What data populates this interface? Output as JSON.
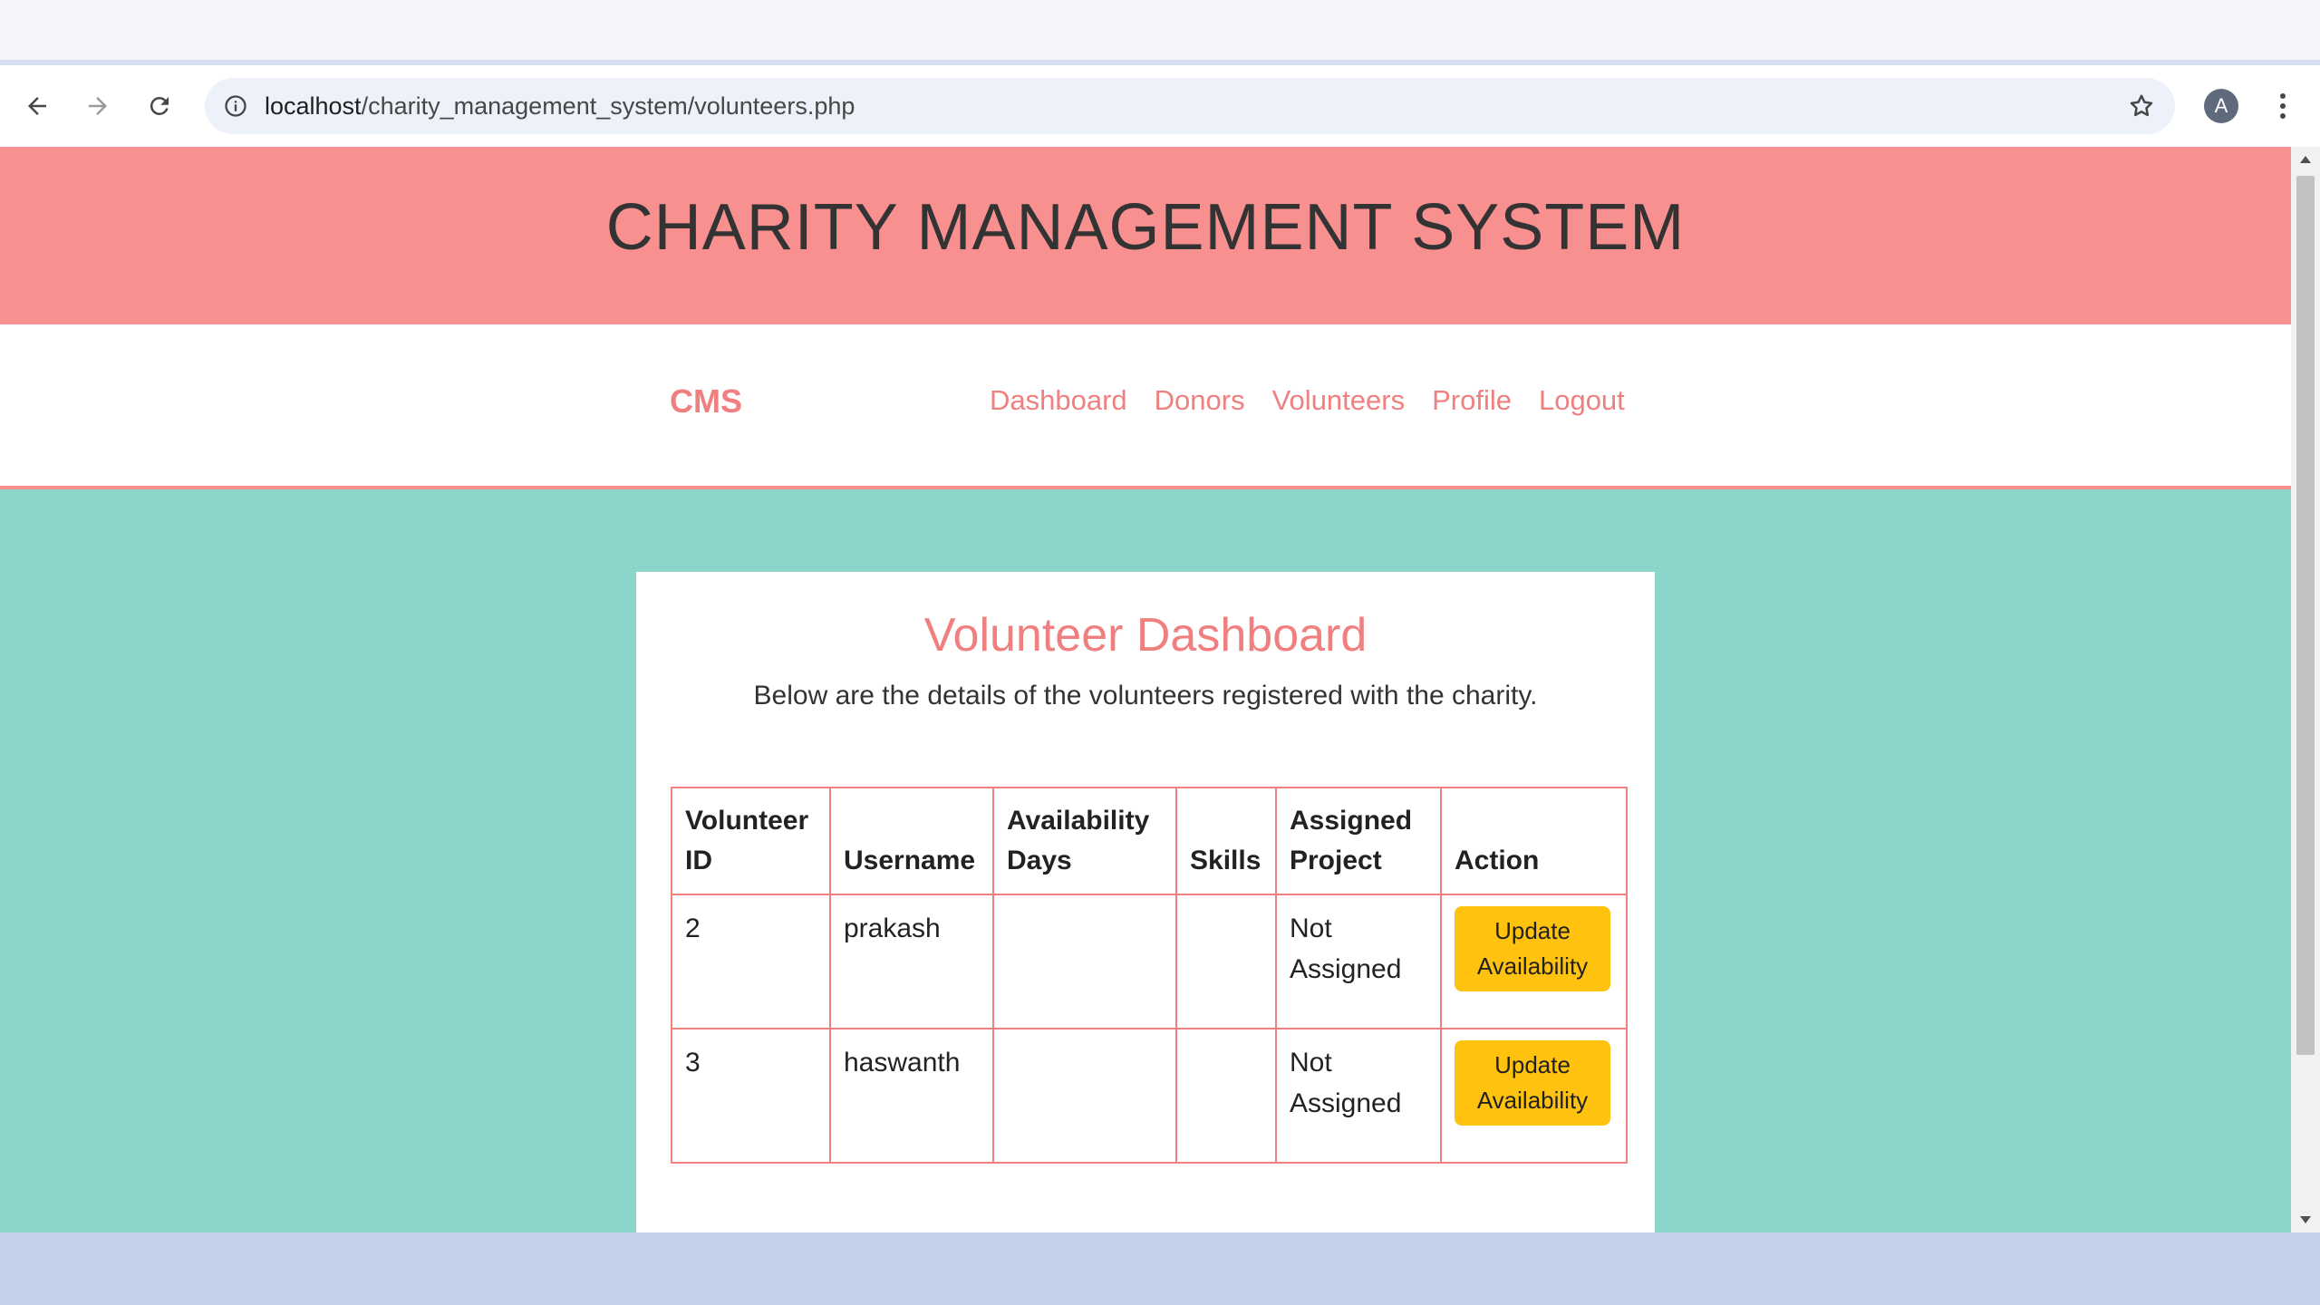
{
  "browser": {
    "url_host": "localhost",
    "url_path": "/charity_management_system/volunteers.php",
    "profile_initial": "A"
  },
  "site": {
    "title": "CHARITY MANAGEMENT SYSTEM",
    "brand": "CMS",
    "nav": [
      "Dashboard",
      "Donors",
      "Volunteers",
      "Profile",
      "Logout"
    ]
  },
  "dashboard": {
    "title": "Volunteer Dashboard",
    "description": "Below are the details of the volunteers registered with the charity.",
    "columns": [
      [
        "Volunteer",
        "ID"
      ],
      [
        "Username"
      ],
      [
        "Availability",
        "Days"
      ],
      [
        "Skills"
      ],
      [
        "Assigned",
        "Project"
      ],
      [
        "Action"
      ]
    ],
    "rows": [
      {
        "id": "2",
        "username": "prakash",
        "availability": "",
        "skills": "",
        "project": [
          "Not",
          "Assigned"
        ],
        "action": [
          "Update",
          "Availability"
        ]
      },
      {
        "id": "3",
        "username": "haswanth",
        "availability": "",
        "skills": "",
        "project": [
          "Not",
          "Assigned"
        ],
        "action": [
          "Update",
          "Availability"
        ]
      }
    ]
  },
  "colors": {
    "header_bg": "#f99090",
    "accent": "#f08080",
    "page_bg": "#8bd5ca",
    "button": "#ffc20e"
  }
}
